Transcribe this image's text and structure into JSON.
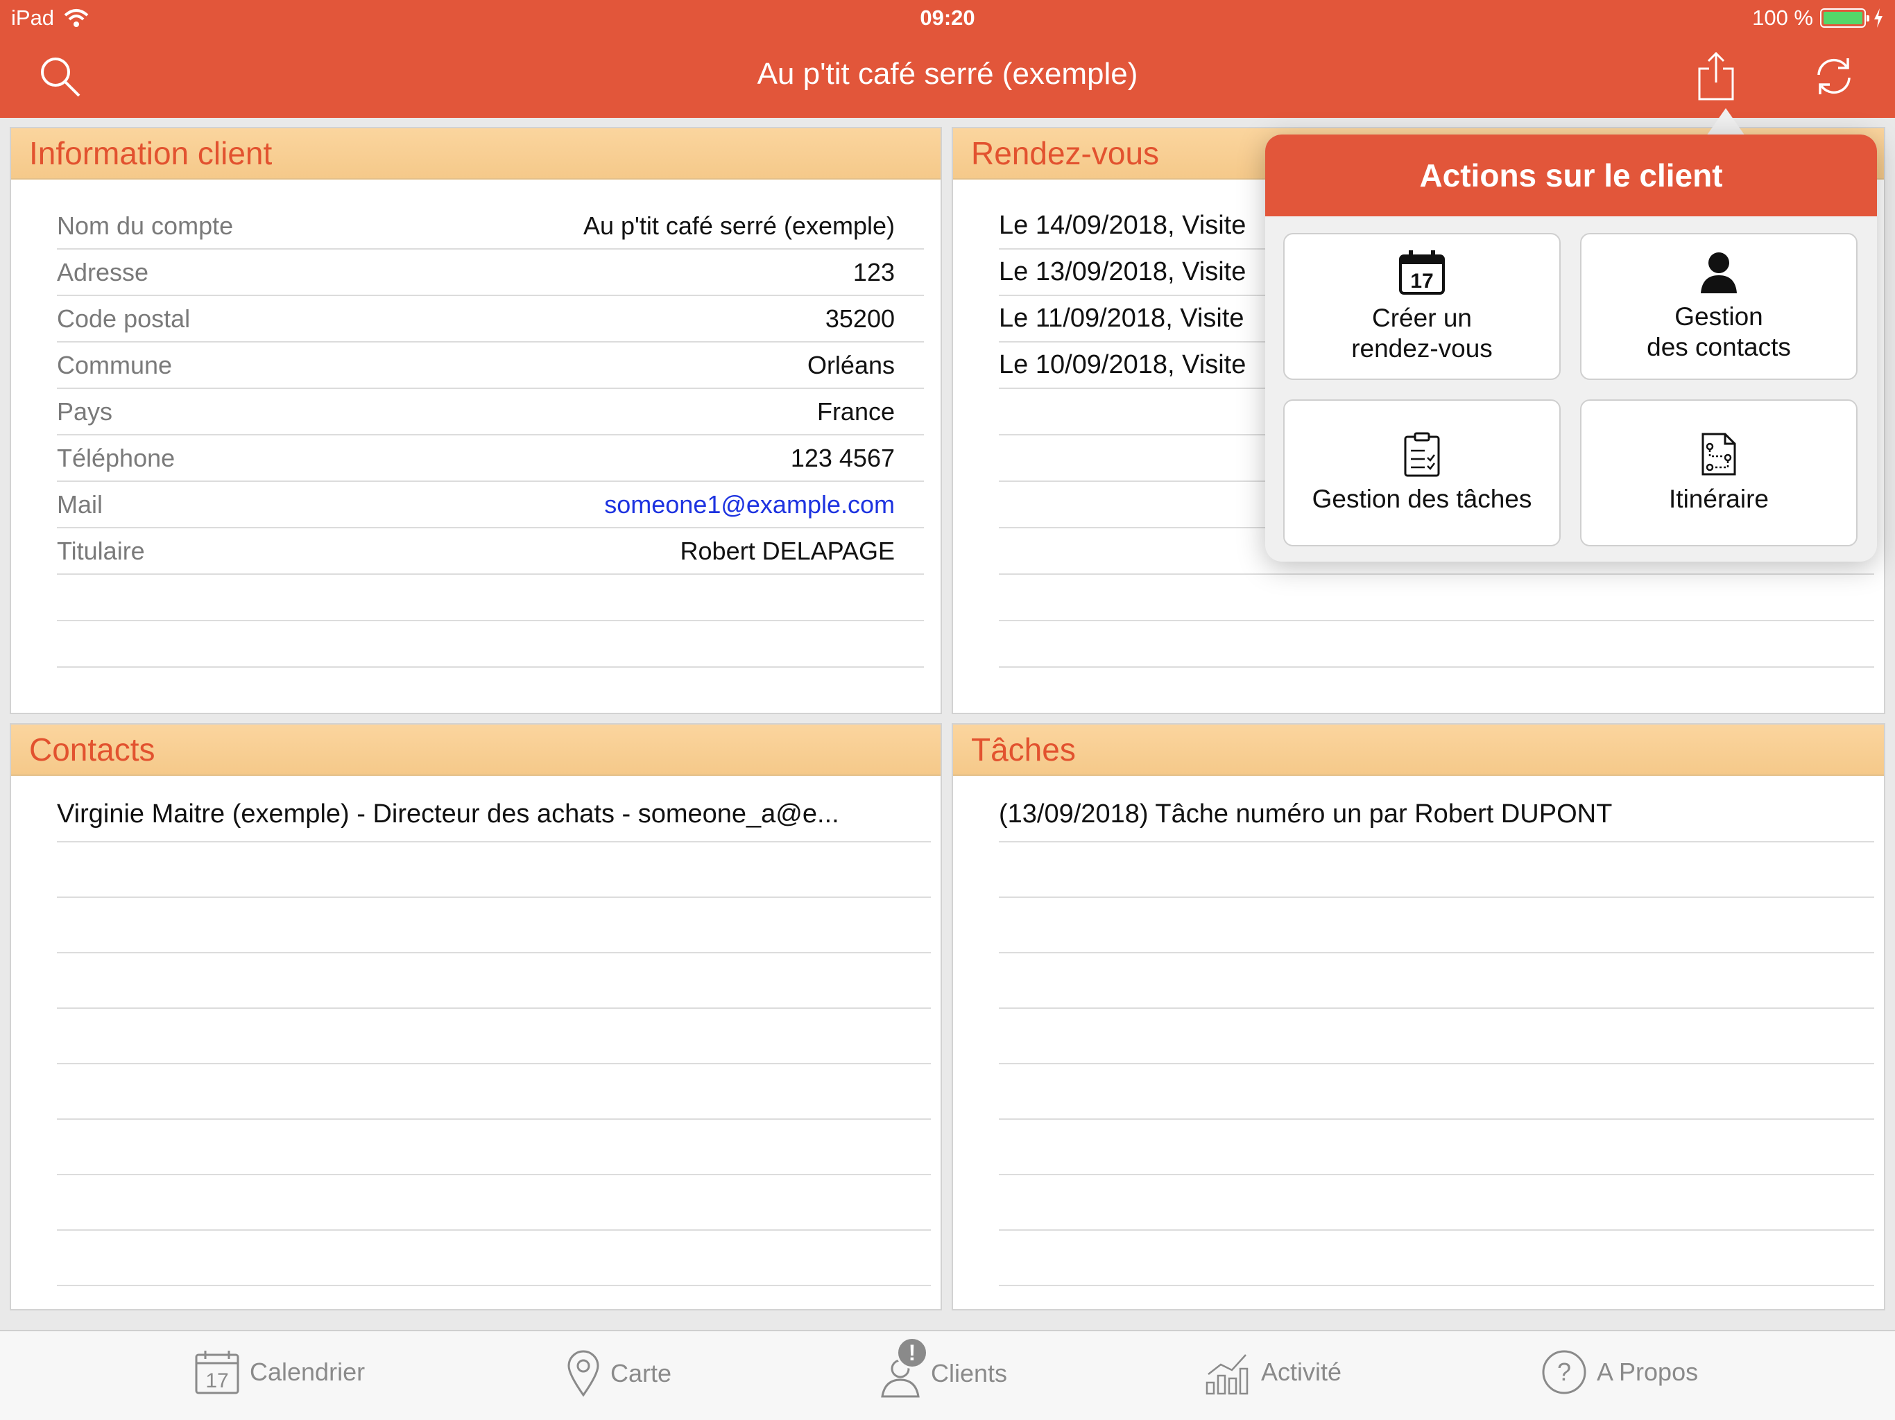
{
  "status_bar": {
    "device": "iPad",
    "time": "09:20",
    "battery": "100 %",
    "battery_level": 1.0
  },
  "nav": {
    "title": "Au p'tit café serré (exemple)",
    "icons": [
      "search-icon",
      "share-icon",
      "refresh-icon"
    ]
  },
  "client_info": {
    "title": "Information client",
    "rows": [
      {
        "label": "Nom du compte",
        "value": "Au p'tit café serré (exemple)"
      },
      {
        "label": "Adresse",
        "value": "123"
      },
      {
        "label": "Code postal",
        "value": "35200"
      },
      {
        "label": "Commune",
        "value": "Orléans"
      },
      {
        "label": "Pays",
        "value": "France"
      },
      {
        "label": "Téléphone",
        "value": "123 4567"
      },
      {
        "label": "Mail",
        "value": "someone1@example.com"
      },
      {
        "label": "Titulaire",
        "value": "Robert DELAPAGE"
      }
    ]
  },
  "appointments": {
    "title": "Rendez-vous",
    "items": [
      "Le 14/09/2018, Visite",
      "Le 13/09/2018, Visite",
      "Le 11/09/2018, Visite",
      "Le 10/09/2018, Visite"
    ]
  },
  "contacts": {
    "title": "Contacts",
    "items": [
      "Virginie Maitre (exemple) - Directeur des achats - someone_a@e..."
    ]
  },
  "tasks": {
    "title": "Tâches",
    "items": [
      "(13/09/2018) Tâche numéro un par Robert DUPONT"
    ]
  },
  "popover": {
    "title": "Actions sur le client",
    "actions": [
      {
        "line1": "Créer un",
        "line2": "rendez-vous",
        "icon": "calendar-icon",
        "icon_text": "17"
      },
      {
        "line1": "Gestion",
        "line2": "des contacts",
        "icon": "person-icon"
      },
      {
        "line1": "Gestion des tâches",
        "line2": "",
        "icon": "clipboard-icon"
      },
      {
        "line1": "Itinéraire",
        "line2": "",
        "icon": "route-icon"
      }
    ]
  },
  "tabbar": {
    "tabs": [
      {
        "label": "Calendrier",
        "icon": "calendar-icon",
        "icon_text": "17"
      },
      {
        "label": "Carte",
        "icon": "map-pin-icon"
      },
      {
        "label": "Clients",
        "icon": "clients-icon",
        "badge": "!"
      },
      {
        "label": "Activité",
        "icon": "activity-icon"
      },
      {
        "label": "A Propos",
        "icon": "help-icon",
        "icon_text": "?"
      }
    ]
  },
  "colors": {
    "accent": "#e2563a",
    "panel_header": "#f9d29b",
    "header_text": "#e2522f",
    "link": "#1d33e0"
  }
}
